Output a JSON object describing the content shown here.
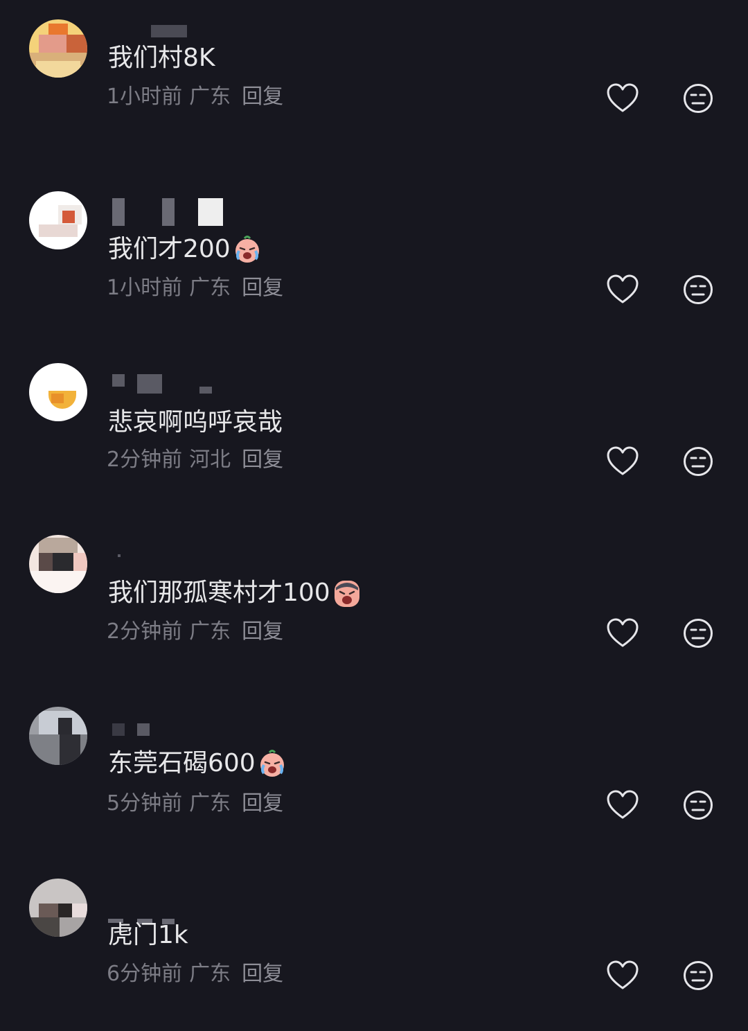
{
  "reply_label": "回复",
  "comments": [
    {
      "text": "我们村8K",
      "time": "1小时前",
      "location": "广东"
    },
    {
      "text": "我们才200",
      "time": "1小时前",
      "location": "广东",
      "emoji": "crying-face"
    },
    {
      "text": "悲哀啊呜呼哀哉",
      "time": "2分钟前",
      "location": "河北"
    },
    {
      "text": "我们那孤寒村才100",
      "time": "2分钟前",
      "location": "广东",
      "emoji": "screaming-face"
    },
    {
      "text": "东莞石碣600",
      "time": "5分钟前",
      "location": "广东",
      "emoji": "crying-face"
    },
    {
      "text": "虎门1k",
      "time": "6分钟前",
      "location": "广东"
    }
  ],
  "icons": {
    "like": "heart-icon",
    "dislike": "meh-face-icon"
  },
  "colors": {
    "background": "#17171f",
    "text": "#e8e8ea",
    "meta": "#7d7d86"
  }
}
